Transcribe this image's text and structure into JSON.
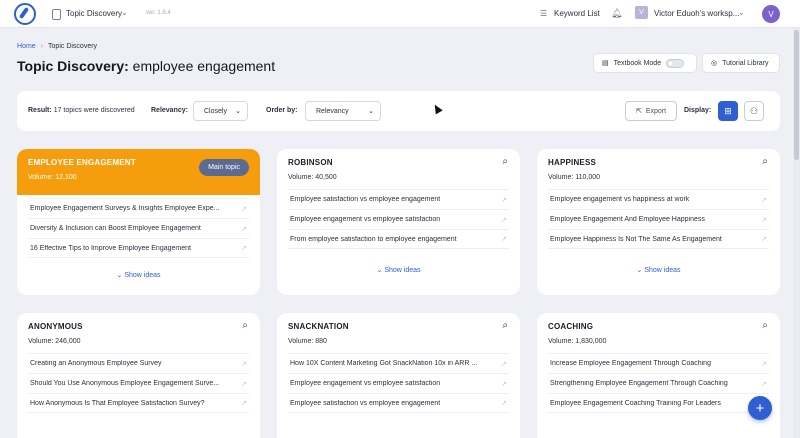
{
  "topbar": {
    "project_name": "Topic Discovery",
    "version": "ver. 1.6.4",
    "keyword_list": "Keyword List",
    "workspace_initial": "V",
    "workspace_name": "Victor Eduoh's worksp...",
    "user_initial": "V"
  },
  "header": {
    "breadcrumb_home": "Home",
    "breadcrumb_current": "Topic Discovery",
    "title_prefix": "Topic Discovery:",
    "title_query": "employee engagement",
    "textbook_mode": "Textbook Mode",
    "toggle_state": "OFF",
    "tutorial_library": "Tutorial Library"
  },
  "toolbar": {
    "result_label": "Result:",
    "result_text": "17 topics were discovered",
    "relevancy_label": "Relevancy:",
    "relevancy_value": "Closely",
    "order_label": "Order by:",
    "order_value": "Relevancy",
    "export_label": "Export",
    "display_label": "Display:"
  },
  "cards": [
    {
      "title": "EMPLOYEE ENGAGEMENT",
      "volume": "Volume: 12,100",
      "main": true,
      "main_label": "Main topic",
      "items": [
        "Employee Engagement Surveys & Insights Employee Expe...",
        "Diversity & Inclusion can Boost Employee Engagement",
        "16 Effective Tips to Improve Employee Engagement"
      ],
      "show_ideas": "Show ideas"
    },
    {
      "title": "ROBINSON",
      "volume": "Volume: 40,500",
      "items": [
        "Employee satisfaction vs employee engagement",
        "Employee engagement vs employee satisfaction",
        "From employee satisfaction to employee engagement"
      ],
      "show_ideas": "Show ideas"
    },
    {
      "title": "HAPPINESS",
      "volume": "Volume: 110,000",
      "items": [
        "Employee engagement vs happiness at work",
        "Employee Engagement And Employee Happiness",
        "Employee Happiness Is Not The Same As Engagement"
      ],
      "show_ideas": "Show ideas"
    },
    {
      "title": "ANONYMOUS",
      "volume": "Volume: 246,000",
      "items": [
        "Creating an Anonymous Employee Survey",
        "Should You Use Anonymous Employee Engagement Surve...",
        "How Anonymous Is That Employee Satisfaction Survey?"
      ]
    },
    {
      "title": "SNACKNATION",
      "volume": "Volume: 880",
      "items": [
        "How 10X Content Marketing Got SnackNation 10x in ARR ...",
        "Employee engagement vs employee satisfaction",
        "Employee satisfaction vs employee engagement"
      ]
    },
    {
      "title": "COACHING",
      "volume": "Volume: 1,830,000",
      "items": [
        "Increase Employee Engagement Through Coaching",
        "Strengthening Employee Engagement Through Coaching",
        "Employee Engagement Coaching Training For Leaders"
      ]
    }
  ]
}
